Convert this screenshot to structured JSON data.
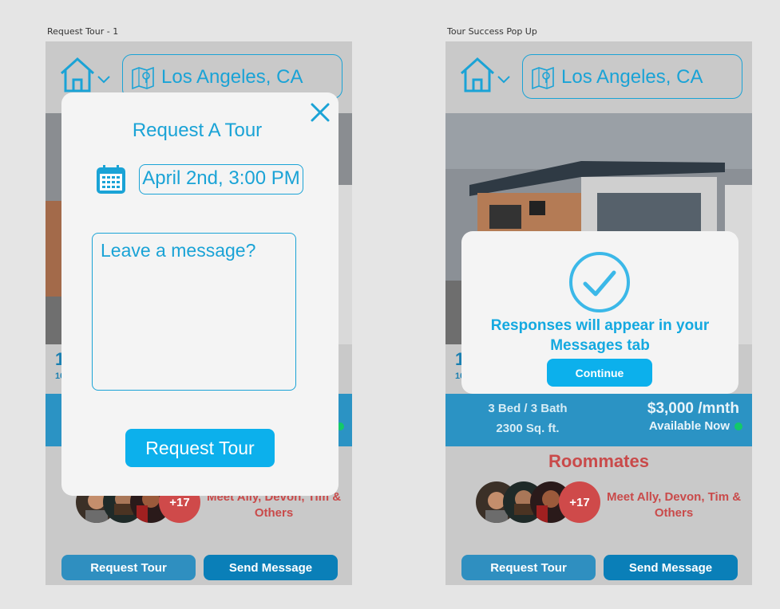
{
  "frames": {
    "frame1_label": "Request Tour - 1",
    "frame2_label": "Tour Success Pop Up"
  },
  "header": {
    "location": "Los Angeles, CA"
  },
  "listing": {
    "beds_baths": "3 Bed / 3 Bath",
    "sqft": "2300 Sq. ft.",
    "price": "$3,000 /mnth",
    "availability": "Available Now",
    "under_big": "1",
    "under_small": "10"
  },
  "roommates": {
    "title": "Roommates",
    "extra_count": "+17",
    "meet_text": "Meet Ally, Devon, Tim & Others"
  },
  "actions": {
    "request_tour": "Request Tour",
    "send_message": "Send Message"
  },
  "tour_modal": {
    "title": "Request A Tour",
    "date_value": "April 2nd, 3:00 PM",
    "message_placeholder": "Leave a message?",
    "submit_label": "Request Tour"
  },
  "success_modal": {
    "message": "Responses will appear in your Messages tab",
    "continue_label": "Continue"
  },
  "colors": {
    "accent": "#1aa3d6",
    "band": "#2b93c4",
    "roommates": "#c94a4a",
    "available": "#13c96a"
  }
}
